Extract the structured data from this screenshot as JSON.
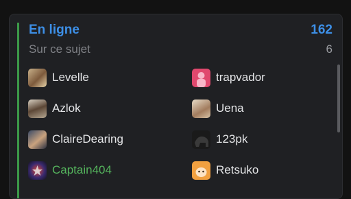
{
  "header": {
    "title": "En ligne",
    "total": "162",
    "subtitle": "Sur ce sujet",
    "subcount": "6"
  },
  "users": [
    {
      "name": "Levelle",
      "avatar_icon": "user-avatar-icon",
      "color": "#e4e5e7"
    },
    {
      "name": "trapvador",
      "avatar_icon": "user-avatar-icon",
      "color": "#e4e5e7"
    },
    {
      "name": "Azlok",
      "avatar_icon": "user-avatar-icon",
      "color": "#e4e5e7"
    },
    {
      "name": "Uena",
      "avatar_icon": "user-avatar-icon",
      "color": "#e4e5e7"
    },
    {
      "name": "ClaireDearing",
      "avatar_icon": "user-avatar-icon",
      "color": "#e4e5e7"
    },
    {
      "name": "123pk",
      "avatar_icon": "user-avatar-icon",
      "color": "#e4e5e7"
    },
    {
      "name": "Captain404",
      "avatar_icon": "user-avatar-icon",
      "color": "#55b45d"
    },
    {
      "name": "Retsuko",
      "avatar_icon": "user-avatar-icon",
      "color": "#e4e5e7"
    }
  ],
  "colors": {
    "accent_blue": "#3d8fe6",
    "accent_green": "#3c9a49",
    "panel_bg": "#1f2023"
  }
}
